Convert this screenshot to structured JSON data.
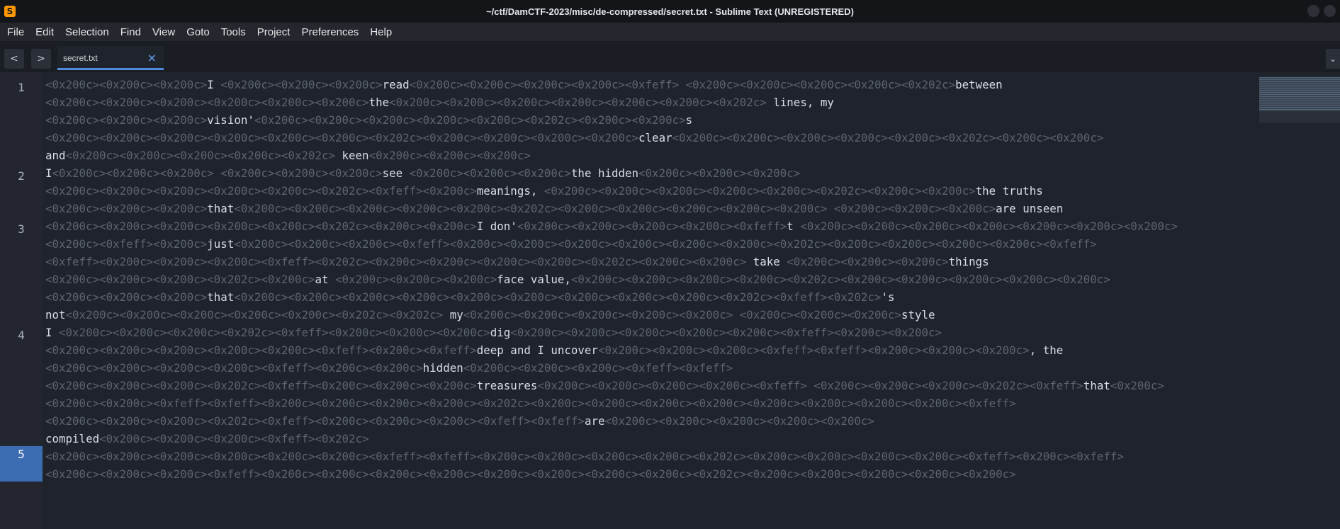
{
  "window": {
    "title": "~/ctf/DamCTF-2023/misc/de-compressed/secret.txt - Sublime Text (UNREGISTERED)"
  },
  "menu": [
    "File",
    "Edit",
    "Selection",
    "Find",
    "View",
    "Goto",
    "Tools",
    "Project",
    "Preferences",
    "Help"
  ],
  "nav": {
    "back": "<",
    "forward": ">",
    "overflow": "⌄"
  },
  "tab": {
    "label": "secret.txt",
    "close": "×"
  },
  "line_numbers": [
    "1",
    "2",
    "3",
    "4",
    "5"
  ],
  "lines": [
    "<0x200c><0x200c><0x200c>I <0x200c><0x200c><0x200c>read<0x200c><0x200c><0x200c><0x200c><0xfeff> <0x200c><0x200c><0x200c><0x200c><0x202c>between",
    "<0x200c><0x200c><0x200c><0x200c><0x200c><0x200c>the<0x200c><0x200c><0x200c><0x200c><0x200c><0x200c><0x202c> lines, my",
    "<0x200c><0x200c><0x200c>vision'<0x200c><0x200c><0x200c><0x200c><0x200c><0x202c><0x200c><0x200c>s",
    "<0x200c><0x200c><0x200c><0x200c><0x200c><0x200c><0x202c><0x200c><0x200c><0x200c><0x200c>clear<0x200c><0x200c><0x200c><0x200c><0x200c><0x202c><0x200c><0x200c>",
    "and<0x200c><0x200c><0x200c><0x200c><0x202c> keen<0x200c><0x200c><0x200c>",
    "I<0x200c><0x200c><0x200c> <0x200c><0x200c><0x200c>see <0x200c><0x200c><0x200c>the hidden<0x200c><0x200c><0x200c>",
    "<0x200c><0x200c><0x200c><0x200c><0x200c><0x202c><0xfeff><0x200c>meanings, <0x200c><0x200c><0x200c><0x200c><0x200c><0x202c><0x200c><0x200c>the truths",
    "<0x200c><0x200c><0x200c>that<0x200c><0x200c><0x200c><0x200c><0x200c><0x202c><0x200c><0x200c><0x200c><0x200c><0x200c> <0x200c><0x200c><0x200c>are unseen",
    "<0x200c><0x200c><0x200c><0x200c><0x200c><0x202c><0x200c><0x200c>I don'<0x200c><0x200c><0x200c><0x200c><0xfeff>t <0x200c><0x200c><0x200c><0x200c><0x200c><0x200c><0x200c>",
    "<0x200c><0xfeff><0x200c>just<0x200c><0x200c><0x200c><0xfeff><0x200c><0x200c><0x200c><0x200c><0x200c><0x200c><0x202c><0x200c><0x200c><0x200c><0x200c><0xfeff>",
    "<0xfeff><0x200c><0x200c><0x200c><0xfeff><0x202c><0x200c><0x200c><0x200c><0x200c><0x202c><0x200c><0x200c> take <0x200c><0x200c><0x200c>things",
    "<0x200c><0x200c><0x200c><0x202c><0x200c>at <0x200c><0x200c><0x200c>face value,<0x200c><0x200c><0x200c><0x200c><0x202c><0x200c><0x200c><0x200c><0x200c><0x200c>",
    "<0x200c><0x200c><0x200c>that<0x200c><0x200c><0x200c><0x200c><0x200c><0x200c><0x200c><0x200c><0x200c><0x202c><0xfeff><0x202c>'s",
    "not<0x200c><0x200c><0x200c><0x200c><0x200c><0x202c><0x202c> my<0x200c><0x200c><0x200c><0x200c><0x200c> <0x200c><0x200c><0x200c>style",
    "I <0x200c><0x200c><0x200c><0x202c><0xfeff><0x200c><0x200c><0x200c>dig<0x200c><0x200c><0x200c><0x200c><0x200c><0xfeff><0x200c><0x200c>",
    "<0x200c><0x200c><0x200c><0x200c><0x200c><0xfeff><0x200c><0xfeff>deep and I uncover<0x200c><0x200c><0x200c><0xfeff><0xfeff><0x200c><0x200c><0x200c>, the",
    "<0x200c><0x200c><0x200c><0x200c><0xfeff><0x200c><0x200c>hidden<0x200c><0x200c><0x200c><0xfeff><0xfeff>",
    "<0x200c><0x200c><0x200c><0x202c><0xfeff><0x200c><0x200c><0x200c>treasures<0x200c><0x200c><0x200c><0x200c><0xfeff> <0x200c><0x200c><0x200c><0x202c><0xfeff>that<0x200c>",
    "<0x200c><0x200c><0xfeff><0xfeff><0x200c><0x200c><0x200c><0x200c><0x202c><0x200c><0x200c><0x200c><0x200c><0x200c><0x200c><0x200c><0x200c><0xfeff>",
    "<0x200c><0x200c><0x200c><0x202c><0xfeff><0x200c><0x200c><0x200c><0xfeff><0xfeff>are<0x200c><0x200c><0x200c><0x200c><0x200c>",
    "compiled<0x200c><0x200c><0x200c><0xfeff><0x202c>",
    "<0x200c><0x200c><0x200c><0x200c><0x200c><0x200c><0xfeff><0xfeff><0x200c><0x200c><0x200c><0x200c><0x202c><0x200c><0x200c><0x200c><0x200c><0xfeff><0x200c><0xfeff>",
    "<0x200c><0x200c><0x200c><0xfeff><0x200c><0x200c><0x200c><0x200c><0x200c><0x200c><0x200c><0x200c><0x202c><0x200c><0x200c><0x200c><0x200c><0x200c>"
  ],
  "colors": {
    "background": "#1f232b",
    "zero_width_marker": "#5d6471",
    "text": "#d8dee9",
    "accent": "#4e8bdf"
  }
}
